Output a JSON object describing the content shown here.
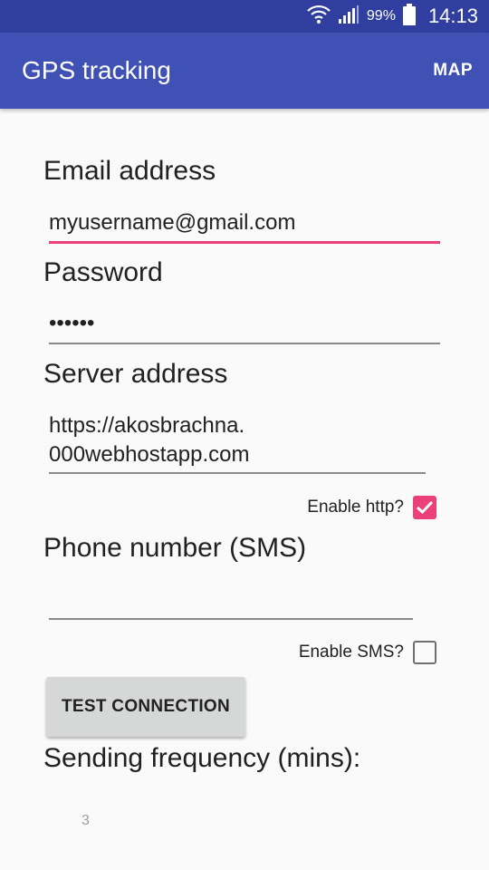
{
  "status_bar": {
    "battery": "99%",
    "time": "14:13"
  },
  "app_bar": {
    "title": "GPS tracking",
    "map_label": "MAP"
  },
  "form": {
    "email_label": "Email address",
    "email_value": "myusername@gmail.com",
    "password_label": "Password",
    "password_value": "••••••",
    "server_label": "Server address",
    "server_value_line1": "https://akosbrachna.",
    "server_value_line2": "000webhostapp.com",
    "enable_http_label": "Enable http?",
    "enable_http_checked": true,
    "phone_label": "Phone number (SMS)",
    "phone_value": "",
    "enable_sms_label": "Enable SMS?",
    "enable_sms_checked": false,
    "test_button_label": "TEST CONNECTION",
    "frequency_label": "Sending frequency (mins):",
    "frequency_value": "3"
  },
  "colors": {
    "primary": "#3f51b5",
    "primary_dark": "#303f9f",
    "accent": "#ec407a"
  }
}
